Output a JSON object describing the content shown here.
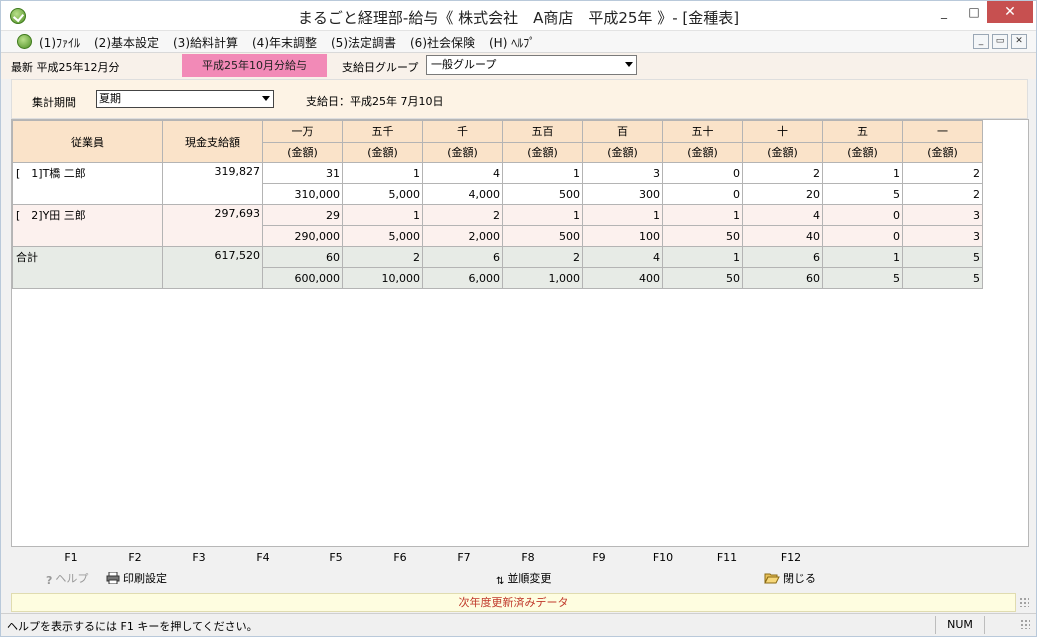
{
  "window": {
    "title": "まるごと経理部-給与《 株式会社　A商店　平成25年 》- [金種表]",
    "min": "_",
    "max": "□",
    "close": "✕",
    "mdi_min": "_",
    "mdi_restore": "▭",
    "mdi_close": "✕"
  },
  "menu": [
    "(1)ﾌｧｲﾙ",
    "(2)基本設定",
    "(3)給料計算",
    "(4)年末調整",
    "(5)法定調書",
    "(6)社会保険",
    "(H) ﾍﾙﾌﾟ"
  ],
  "info": {
    "latest": "最新 平成25年12月分",
    "payroll": "平成25年10月分給与",
    "group_label": "支給日グループ",
    "group_value": "一般グループ"
  },
  "period": {
    "label": "集計期間",
    "value": "夏期",
    "payday": "支給日：平成25年 7月10日"
  },
  "table": {
    "head_employee": "従業員",
    "head_total": "現金支給額",
    "denoms": [
      "一万",
      "五千",
      "千",
      "五百",
      "百",
      "五十",
      "十",
      "五",
      "一"
    ],
    "sub_label": "(金額)",
    "rows": [
      {
        "name": "[　1]T橋 二郎",
        "amount": "319,827",
        "counts": [
          "31",
          "1",
          "4",
          "1",
          "3",
          "0",
          "2",
          "1",
          "2"
        ],
        "amounts": [
          "310,000",
          "5,000",
          "4,000",
          "500",
          "300",
          "0",
          "20",
          "5",
          "2"
        ]
      },
      {
        "name": "[　2]Y田 三郎",
        "amount": "297,693",
        "counts": [
          "29",
          "1",
          "2",
          "1",
          "1",
          "1",
          "4",
          "0",
          "3"
        ],
        "amounts": [
          "290,000",
          "5,000",
          "2,000",
          "500",
          "100",
          "50",
          "40",
          "0",
          "3"
        ]
      },
      {
        "name": "合計",
        "amount": "617,520",
        "counts": [
          "60",
          "2",
          "6",
          "2",
          "4",
          "1",
          "6",
          "1",
          "5"
        ],
        "amounts": [
          "600,000",
          "10,000",
          "6,000",
          "1,000",
          "400",
          "50",
          "60",
          "5",
          "5"
        ]
      }
    ]
  },
  "fkeys": {
    "labels": [
      "F1",
      "F2",
      "F3",
      "F4",
      "F5",
      "F6",
      "F7",
      "F8",
      "F9",
      "F10",
      "F11",
      "F12"
    ],
    "help": "ヘルプ",
    "print": "印刷設定",
    "sort": "並順変更",
    "close": "閉じる"
  },
  "notice": "次年度更新済みデータ",
  "status": {
    "text": "ヘルプを表示するには F1 キーを押してください。",
    "num": "NUM"
  },
  "colors": {
    "payroll_badge": "#f28ab7",
    "header_bg": "#fae3c9",
    "notice_text": "#c0392b"
  }
}
